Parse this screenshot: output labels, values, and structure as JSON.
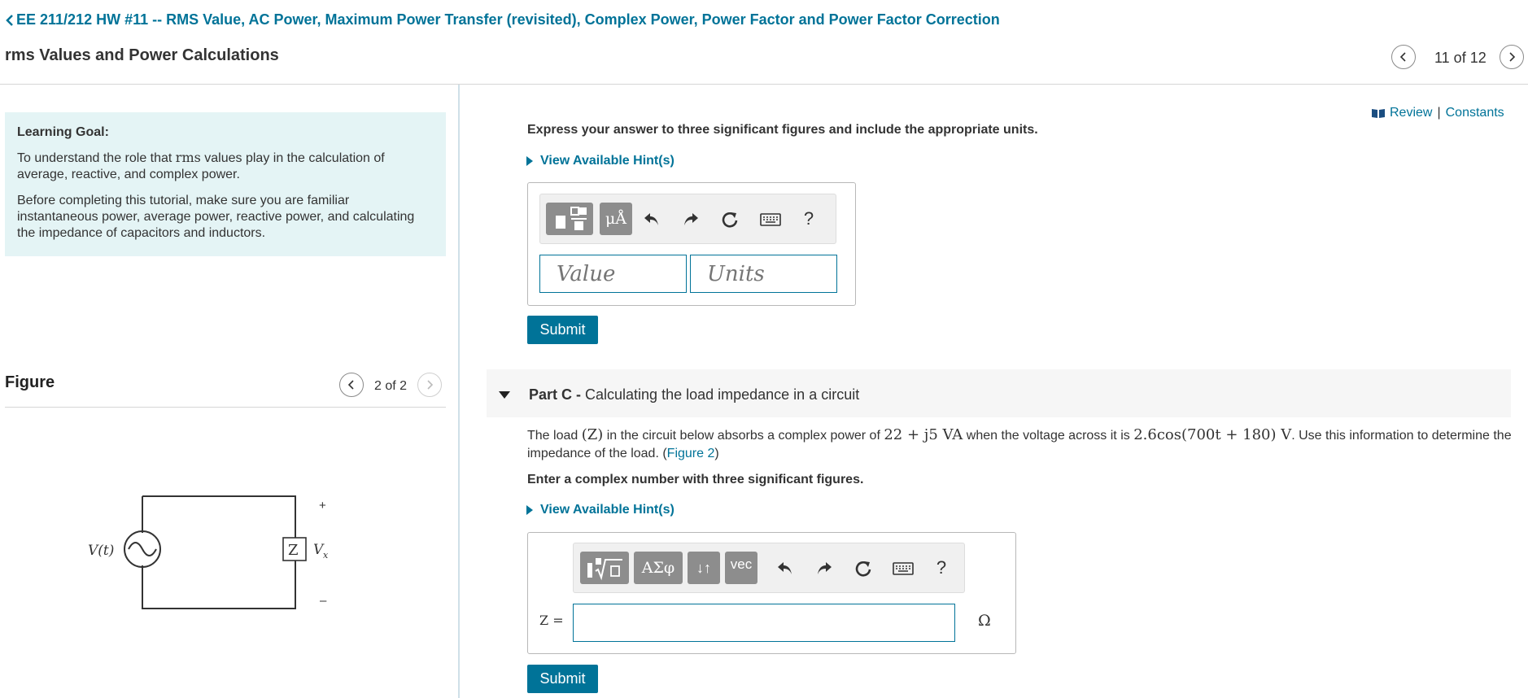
{
  "header": {
    "assignment_title": "EE 211/212 HW #11 -- RMS Value, AC Power, Maximum Power Transfer (revisited), Complex Power, Power Factor and Power Factor Correction",
    "page_title": "rms Values and Power Calculations",
    "item_counter": "11 of 12"
  },
  "learning_goal": {
    "title": "Learning Goal:",
    "p1_before": "To understand the role that ",
    "p1_math": "rms",
    "p1_after": " values play in the calculation of average, reactive, and complex power.",
    "p2": "Before completing this tutorial, make sure you are familiar instantaneous power, average power, reactive power, and calculating the impedance of capacitors and inductors."
  },
  "figure": {
    "title": "Figure",
    "counter": "2 of 2",
    "source_label": "V(t)",
    "impedance_label": "Z",
    "voltage_label": "V",
    "voltage_subscript": "x",
    "plus": "+",
    "minus": "–"
  },
  "review": {
    "review_label": "Review",
    "separator": "|",
    "constants_label": "Constants"
  },
  "part_b": {
    "instruction": "Express your answer to three significant figures and include the appropriate units.",
    "hint_label": "View Available Hint(s)",
    "toolbar": {
      "units_button": "μÅ",
      "help": "?"
    },
    "value_placeholder": "Value",
    "units_placeholder": "Units",
    "submit_label": "Submit"
  },
  "part_c": {
    "label": "Part C -",
    "title": " Calculating the load impedance in a circuit",
    "text_1": "The load ",
    "math_z": "(Z)",
    "text_2": " in the circuit below absorbs a complex power of ",
    "math_power": "22 + j5 VA",
    "text_3": " when the voltage across it is ",
    "math_voltage": "2.6cos(700t + 180) V",
    "text_4": ".  Use this information to determine the impedance of the load. (",
    "figure_link": "Figure 2",
    "text_5": ")",
    "instruction": "Enter a complex number with three significant figures.",
    "hint_label": "View Available Hint(s)",
    "toolbar": {
      "greek_button": "ΑΣφ",
      "arrows_button": "↓↑",
      "vec_button": "vec",
      "help": "?"
    },
    "input_label": "Z =",
    "input_value": "",
    "unit": "Ω",
    "submit_label": "Submit"
  },
  "colors": {
    "accent": "#007398",
    "goal_background": "#e4f4f5",
    "toolbar_button": "#8d8d8d"
  }
}
